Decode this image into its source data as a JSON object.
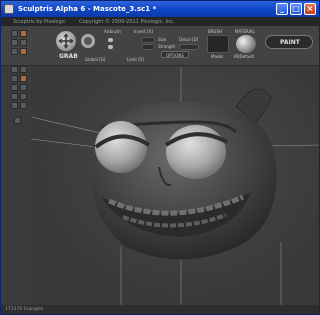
{
  "window": {
    "title": "Sculptris Alpha 6 - Mascote_3.sc1 *",
    "controls": [
      "_",
      "□",
      "×"
    ]
  },
  "menubar": {
    "app_name": "Sculptris by Pixologic",
    "copyright": "Copyright © 2009-2011 Pixologic, Inc."
  },
  "toolbar": {
    "tool_name": "GRAB",
    "labels": {
      "airbrush": "Airbrush",
      "invert": "Invert [X]",
      "size": "Size",
      "strength": "Strength",
      "detail": "Detail [D]",
      "options": "OPTIONS",
      "global": "Global [G]",
      "limit": "Limit [S]",
      "brush": "BRUSH",
      "material": "MATERIAL",
      "mask": "Masks",
      "material_name": "PDDefault",
      "paint": "PAINT"
    }
  },
  "status": {
    "triangles": "171270 triangles"
  },
  "colors": {
    "titlebar": "#0e45c5",
    "panel": "#434343",
    "accent": "#b06a3a",
    "viewport": "#3e3e3e"
  },
  "icons": [
    "app-icon",
    "grab-tool-icon",
    "brush-icon",
    "material-sphere-icon",
    "tool-button-icon",
    "minimize-icon",
    "maximize-icon",
    "close-icon"
  ]
}
